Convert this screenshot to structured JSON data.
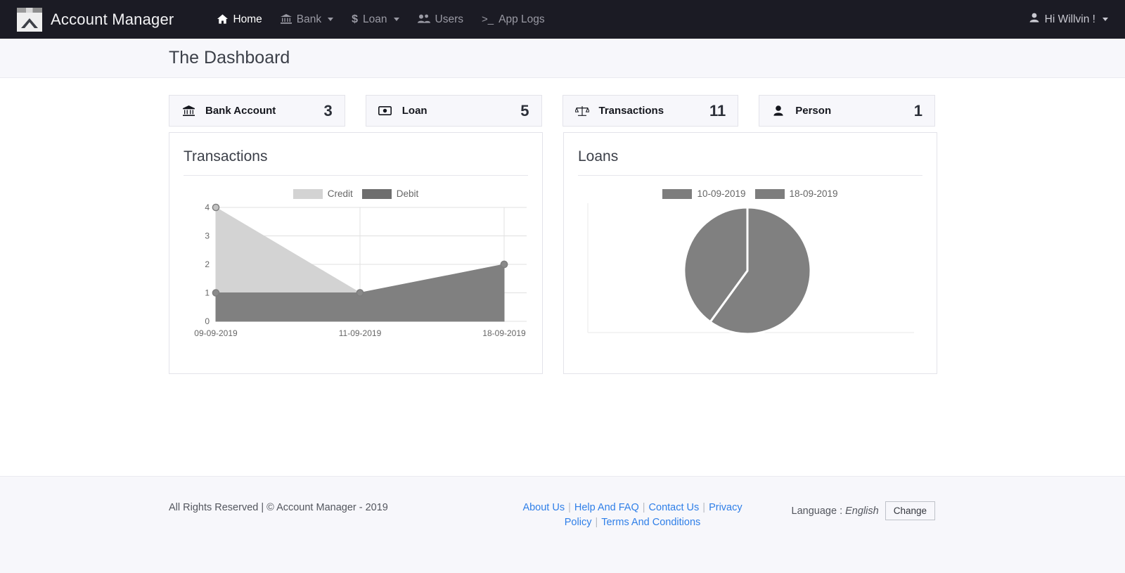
{
  "navbar": {
    "brand": "Account Manager",
    "links": [
      {
        "label": "Home",
        "icon": "home-icon",
        "glyph": "⌂",
        "active": true,
        "caret": false
      },
      {
        "label": "Bank",
        "icon": "bank-icon",
        "glyph": "🏛",
        "active": false,
        "caret": true
      },
      {
        "label": "Loan",
        "icon": "dollar-icon",
        "glyph": "$",
        "active": false,
        "caret": true
      },
      {
        "label": "Users",
        "icon": "users-icon",
        "glyph": "👥",
        "active": false,
        "caret": false
      },
      {
        "label": "App Logs",
        "icon": "terminal-icon",
        "glyph": ">_",
        "active": false,
        "caret": false
      }
    ],
    "user": {
      "greeting": "Hi Willvin !",
      "icon": "user-icon"
    }
  },
  "page": {
    "title": "The Dashboard"
  },
  "stats": [
    {
      "label": "Bank Account",
      "value": "3",
      "icon": "bank-icon"
    },
    {
      "label": "Loan",
      "value": "5",
      "icon": "money-bill-icon"
    },
    {
      "label": "Transactions",
      "value": "11",
      "icon": "balance-scale-icon"
    },
    {
      "label": "Person",
      "value": "1",
      "icon": "user-icon"
    }
  ],
  "panels": {
    "transactions": {
      "title": "Transactions"
    },
    "loans": {
      "title": "Loans"
    }
  },
  "chart_data": [
    {
      "type": "area",
      "title": "Transactions",
      "x": [
        "09-09-2019",
        "11-09-2019",
        "18-09-2019"
      ],
      "categories": [
        "09-09-2019",
        "11-09-2019",
        "18-09-2019"
      ],
      "series": [
        {
          "name": "Credit",
          "values": [
            4,
            1,
            2
          ],
          "color": "#d3d3d3"
        },
        {
          "name": "Debit",
          "values": [
            1,
            1,
            2
          ],
          "color": "#808080"
        }
      ],
      "legend": [
        "Credit",
        "Debit"
      ],
      "legend_position": "top",
      "xlabel": "",
      "ylabel": "",
      "ylim": [
        0,
        4
      ],
      "yticks": [
        0,
        1,
        2,
        3,
        4
      ],
      "grid": true
    },
    {
      "type": "pie",
      "title": "Loans",
      "labels": [
        "10-09-2019",
        "18-09-2019"
      ],
      "legend": [
        "10-09-2019",
        "18-09-2019"
      ],
      "legend_position": "top",
      "values": [
        60,
        40
      ],
      "colors": [
        "#808080",
        "#808080"
      ],
      "grid": false
    }
  ],
  "footer": {
    "copyright": "All Rights Reserved | © Account Manager - 2019",
    "links": [
      "About Us",
      "Help And FAQ",
      "Contact Us",
      "Privacy Policy",
      "Terms And Conditions"
    ],
    "separator": "|",
    "language_label": "Language :",
    "language_value": "English",
    "change_button": "Change"
  }
}
